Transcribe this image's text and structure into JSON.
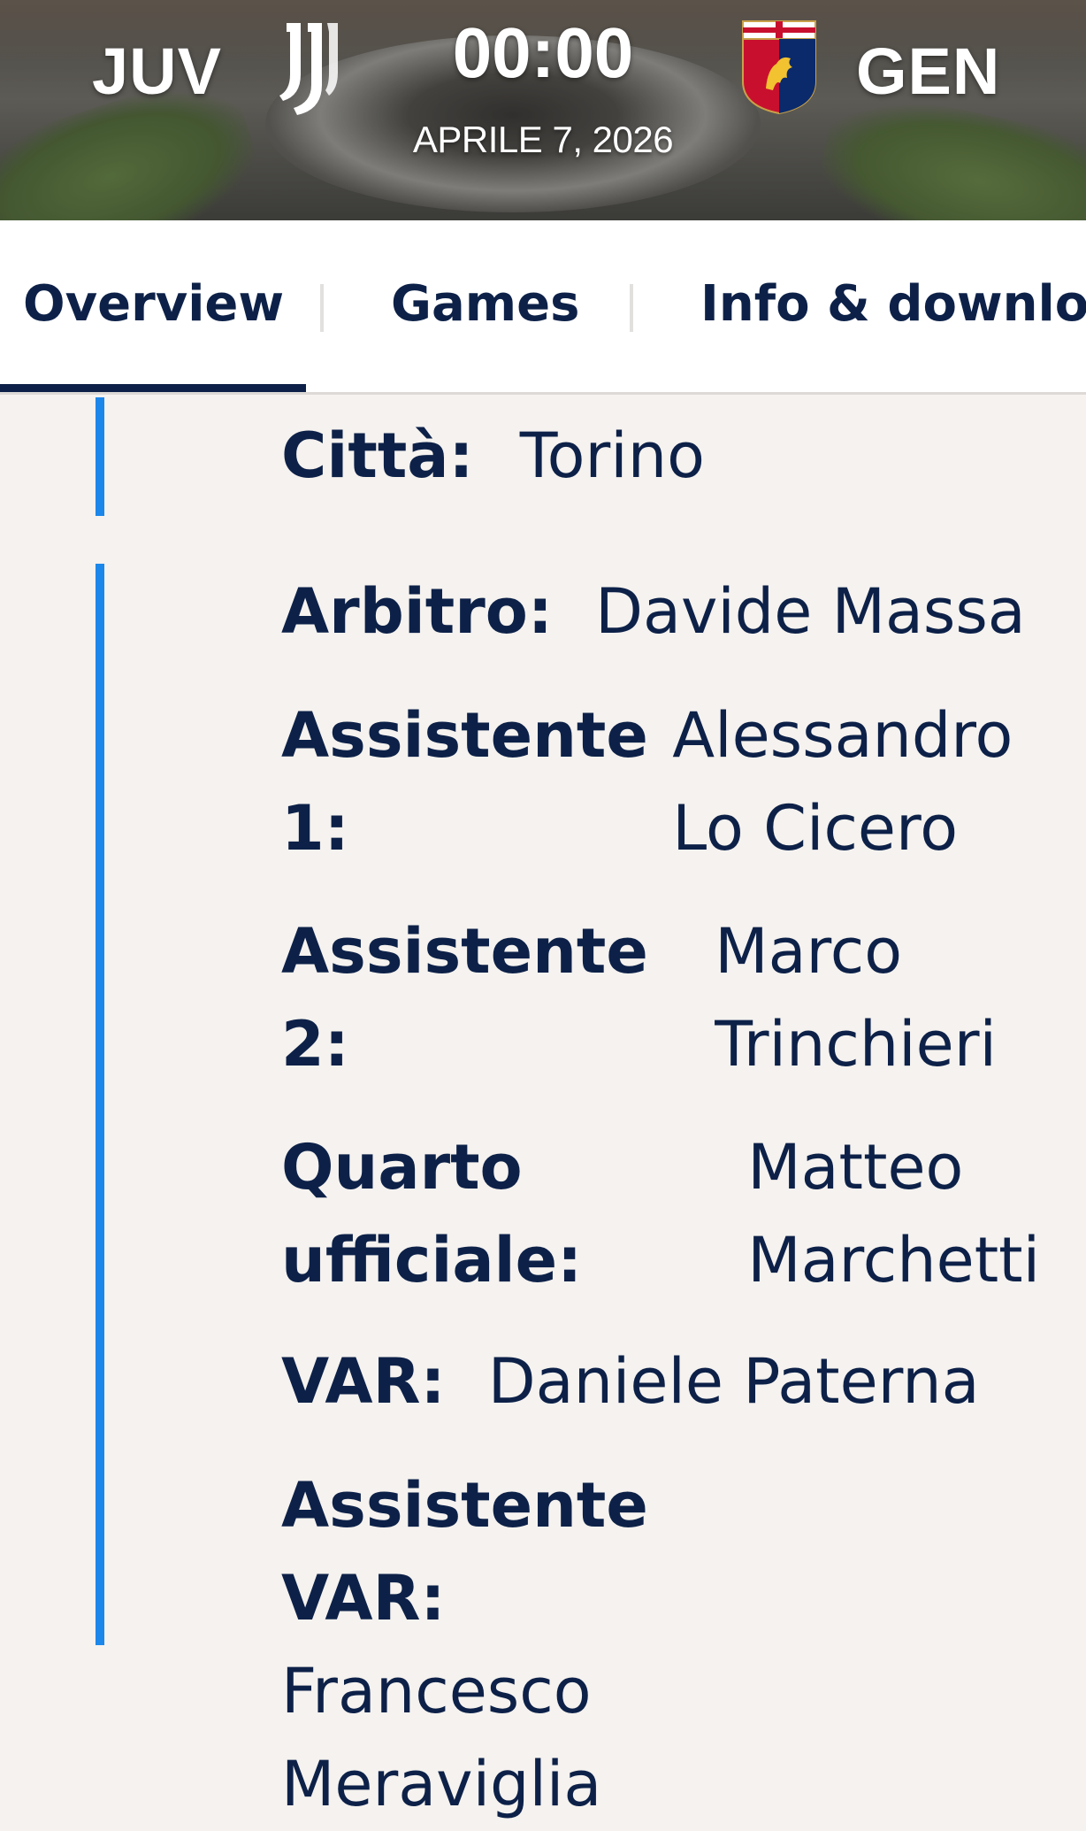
{
  "header": {
    "home_code": "JUV",
    "away_code": "GEN",
    "time": "00:00",
    "date": "APRILE 7, 2026"
  },
  "tabs": [
    {
      "label": "Overview"
    },
    {
      "label": "Games"
    },
    {
      "label": "Info & downloa"
    }
  ],
  "info": {
    "city_label": "Città:",
    "city_value": "Torino",
    "officials": [
      {
        "label": "Arbitro:",
        "value": "Davide Massa"
      },
      {
        "label": "Assistente 1:",
        "value": "Alessandro Lo Cicero"
      },
      {
        "label": "Assistente 2:",
        "value": "Marco Trinchieri"
      },
      {
        "label": "Quarto ufficiale:",
        "value": "Matteo Marchetti"
      },
      {
        "label": "VAR:",
        "value": "Daniele Paterna"
      },
      {
        "label": "Assistente VAR:",
        "value": "Francesco Meraviglia"
      }
    ]
  },
  "colors": {
    "navy": "#0d2148",
    "accent_blue": "#1c87ea",
    "background": "#f5f2ef"
  },
  "icons": {
    "home_logo": "juventus-logo-icon",
    "away_logo": "genoa-crest-icon"
  }
}
